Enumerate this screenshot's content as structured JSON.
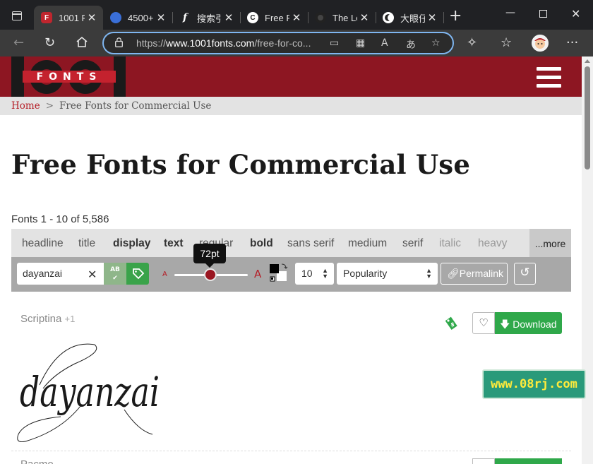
{
  "browser": {
    "tabs": [
      {
        "title": "1001 F",
        "favicon": "F",
        "favicon_color": "#c0262e"
      },
      {
        "title": "4500+",
        "favicon": "",
        "favicon_color": "#3a6fd8"
      },
      {
        "title": "搜索引",
        "favicon": "f",
        "favicon_color": "#111111"
      },
      {
        "title": "Free F",
        "favicon": "C",
        "favicon_color": "#ffffff"
      },
      {
        "title": "The Lo",
        "favicon": "",
        "favicon_color": "#222222"
      },
      {
        "title": "大眼仔",
        "favicon": "",
        "favicon_color": "#ffffff"
      }
    ],
    "url_prefix": "https://",
    "url_host": "www.1001fonts.com",
    "url_path": "/free-for-co..."
  },
  "site": {
    "logo_text": "FONTS",
    "breadcrumb": {
      "home": "Home",
      "separator": ">",
      "current": "Free Fonts for Commercial Use"
    },
    "title": "Free Fonts for Commercial Use",
    "count": "Fonts 1 - 10 of 5,586"
  },
  "tags": [
    "headline",
    "title",
    "display",
    "text",
    "regular",
    "bold",
    "sans serif",
    "medium",
    "serif",
    "italic",
    "heavy"
  ],
  "more_label": "...more",
  "controls": {
    "preview_text": "dayanzai",
    "size_small": "A",
    "size_large": "A",
    "size_tooltip": "72pt",
    "size_value": 72,
    "per_page": "10",
    "sort": "Popularity",
    "permalink": "Permalink"
  },
  "fonts": [
    {
      "name": "Scriptina",
      "extra": "+1",
      "download": "Download",
      "preview": "dayanzai"
    },
    {
      "name": "Pacmo..."
    }
  ],
  "watermark": "www.08rj.com",
  "colors": {
    "brand": "#8d1622",
    "download": "#2fa84a",
    "accent_red": "#b51d26"
  }
}
